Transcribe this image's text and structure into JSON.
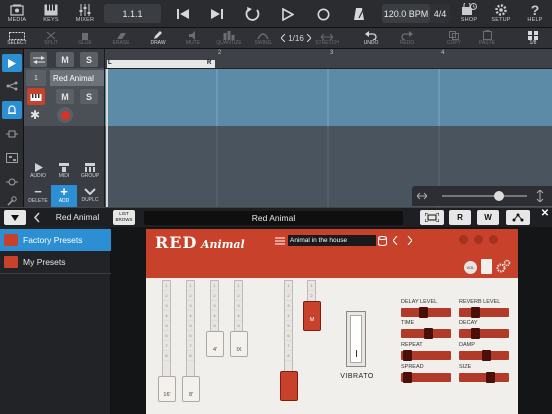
{
  "toolbar": {
    "media": "MEDIA",
    "keys": "KEYS",
    "mixer": "MIXER",
    "position": "1.1.1",
    "tempo": "120.0 BPM",
    "signature": "4/4",
    "shop": "SHOP",
    "setup": "SETUP",
    "help": "HELP"
  },
  "editbar": {
    "select": "SELECT",
    "split": "SPLIT",
    "glue": "GLUE",
    "erase": "ERASE",
    "draw": "DRAW",
    "mute": "MUTE",
    "quantize": "QUANTIZE",
    "quantize_value": "1/16",
    "swing": "SWING",
    "stretch": "STRETCH",
    "undo": "UNDO",
    "redo": "REDO",
    "copy": "COPY",
    "paste": "PASTE",
    "grid": "1/8"
  },
  "track": {
    "number": "1",
    "name": "Red Animal",
    "mute": "M",
    "solo": "S"
  },
  "trackbuttons": {
    "audio": "AUDIO",
    "midi": "MIDI",
    "group": "GROUP",
    "delete": "DELETE",
    "add": "ADD",
    "duplicate": "DUPLC"
  },
  "ruler": {
    "bars": [
      "2",
      "3",
      "4"
    ],
    "loop_left": "L",
    "loop_right": "R"
  },
  "instrument": {
    "name": "Red Animal",
    "list_browse": "LIST\nBROWS",
    "title": "Red Animal",
    "btn_r": "R",
    "btn_w": "W"
  },
  "browser": {
    "items": [
      "Factory Presets",
      "My Presets"
    ]
  },
  "plugin": {
    "logo_main": "RED",
    "logo_sub": "Animal",
    "preset_name": "Animal in the house",
    "vol_label": "VOL",
    "drawbar_labels": [
      "16'",
      "8'",
      "4'",
      "IX"
    ],
    "m_label": "M",
    "vibrato": "VIBRATO",
    "drawbar_numbers": [
      "1",
      "2",
      "3",
      "4",
      "5",
      "6",
      "7",
      "8"
    ],
    "sliders": [
      {
        "label": "DELAY LEVEL",
        "value": 0.45
      },
      {
        "label": "REVERB LEVEL",
        "value": 0.3
      },
      {
        "label": "TIME",
        "value": 0.55
      },
      {
        "label": "DECAY",
        "value": 0.3
      },
      {
        "label": "REPEAT",
        "value": 0.05
      },
      {
        "label": "DAMP",
        "value": 0.55
      },
      {
        "label": "SPREAD",
        "value": 0.05
      },
      {
        "label": "SIZE",
        "value": 0.65
      }
    ]
  },
  "colors": {
    "accent": "#2c8fd4",
    "brand_red": "#c8412b",
    "lane_blue": "#5c8ba8"
  }
}
